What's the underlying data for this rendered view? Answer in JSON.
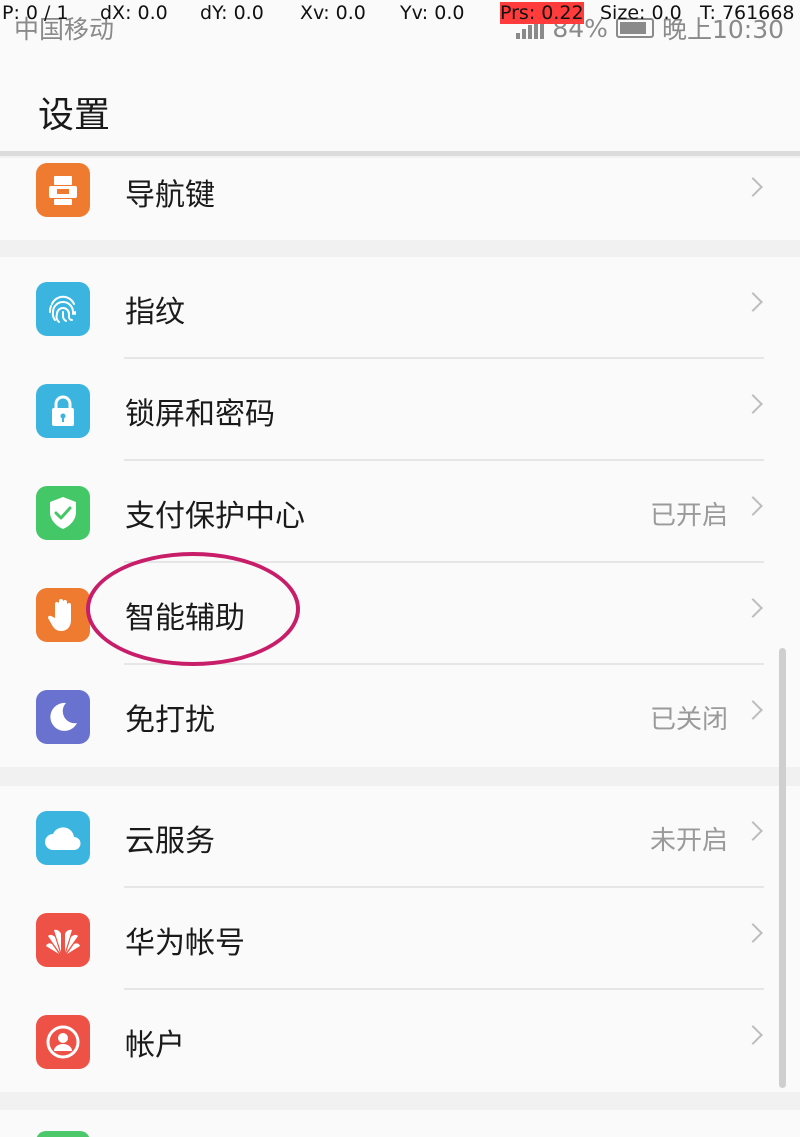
{
  "status_bar": {
    "carrier": "中国移动",
    "battery": "84%",
    "time": "晚上10:30"
  },
  "debug_overlay": {
    "p": "P: 0 / 1",
    "dx": "dX: 0.0",
    "dy": "dY: 0.0",
    "xv": "Xv: 0.0",
    "yv": "Yv: 0.0",
    "prs": "Prs: 0.22",
    "size": "Size: 0.0",
    "t": "T: 761668"
  },
  "header": {
    "title": "设置"
  },
  "groups": [
    {
      "items": [
        {
          "label": "导航键",
          "status": "",
          "icon": "navigation-key-icon",
          "color": "#ef7b30"
        }
      ]
    },
    {
      "items": [
        {
          "label": "指纹",
          "status": "",
          "icon": "fingerprint-icon",
          "color": "#3bb5df"
        },
        {
          "label": "锁屏和密码",
          "status": "",
          "icon": "lock-icon",
          "color": "#3bb5df"
        },
        {
          "label": "支付保护中心",
          "status": "已开启",
          "icon": "shield-check-icon",
          "color": "#44c767"
        },
        {
          "label": "智能辅助",
          "status": "",
          "icon": "hand-icon",
          "color": "#ef7b30"
        },
        {
          "label": "免打扰",
          "status": "已关闭",
          "icon": "moon-icon",
          "color": "#6a72cf"
        }
      ]
    },
    {
      "items": [
        {
          "label": "云服务",
          "status": "未开启",
          "icon": "cloud-icon",
          "color": "#3bb5df"
        },
        {
          "label": "华为帐号",
          "status": "",
          "icon": "huawei-logo-icon",
          "color": "#ee5246"
        },
        {
          "label": "帐户",
          "status": "",
          "icon": "account-icon",
          "color": "#ee5246"
        }
      ]
    }
  ]
}
